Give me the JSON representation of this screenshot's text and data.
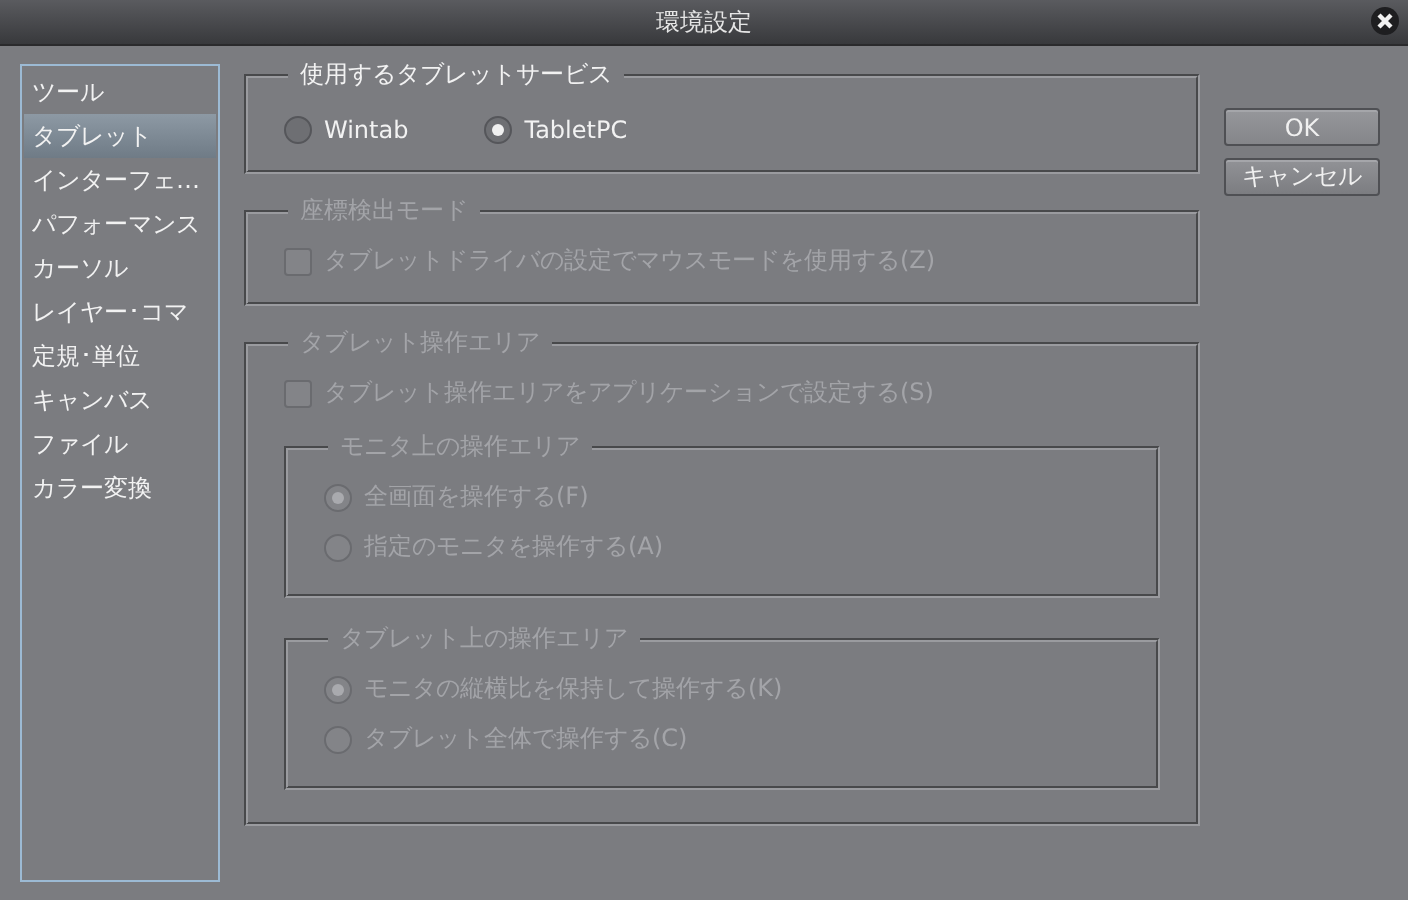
{
  "window": {
    "title": "環境設定"
  },
  "sidebar": {
    "items": [
      {
        "label": "ツール",
        "selected": false
      },
      {
        "label": "タブレット",
        "selected": true
      },
      {
        "label": "インターフェ…",
        "selected": false
      },
      {
        "label": "パフォーマンス",
        "selected": false
      },
      {
        "label": "カーソル",
        "selected": false
      },
      {
        "label": "レイヤー･コマ",
        "selected": false
      },
      {
        "label": "定規･単位",
        "selected": false
      },
      {
        "label": "キャンバス",
        "selected": false
      },
      {
        "label": "ファイル",
        "selected": false
      },
      {
        "label": "カラー変換",
        "selected": false
      }
    ]
  },
  "groups": [
    {
      "title": "使用するタブレットサービス",
      "disabled": false,
      "kind": "inline",
      "items": [
        {
          "kind": "radio",
          "label": "Wintab",
          "selected": false
        },
        {
          "kind": "radio",
          "label": "TabletPC",
          "selected": true
        }
      ]
    },
    {
      "title": "座標検出モード",
      "disabled": true,
      "kind": "stacked",
      "items": [
        {
          "kind": "checkbox",
          "label": "タブレットドライバの設定でマウスモードを使用する(Z)",
          "checked": false
        }
      ]
    },
    {
      "title": "タブレット操作エリア",
      "disabled": true,
      "kind": "stacked",
      "items": [
        {
          "kind": "checkbox",
          "label": "タブレット操作エリアをアプリケーションで設定する(S)",
          "checked": false
        }
      ],
      "groups": [
        {
          "title": "モニタ上の操作エリア",
          "disabled": true,
          "kind": "stacked",
          "items": [
            {
              "kind": "radio",
              "label": "全画面を操作する(F)",
              "selected": true
            },
            {
              "kind": "radio",
              "label": "指定のモニタを操作する(A)",
              "selected": false
            }
          ]
        },
        {
          "title": "タブレット上の操作エリア",
          "disabled": true,
          "kind": "stacked",
          "items": [
            {
              "kind": "radio",
              "label": "モニタの縦横比を保持して操作する(K)",
              "selected": true
            },
            {
              "kind": "radio",
              "label": "タブレット全体で操作する(C)",
              "selected": false
            }
          ]
        }
      ]
    }
  ],
  "buttons": [
    {
      "label": "OK"
    },
    {
      "label": "キャンセル"
    }
  ]
}
